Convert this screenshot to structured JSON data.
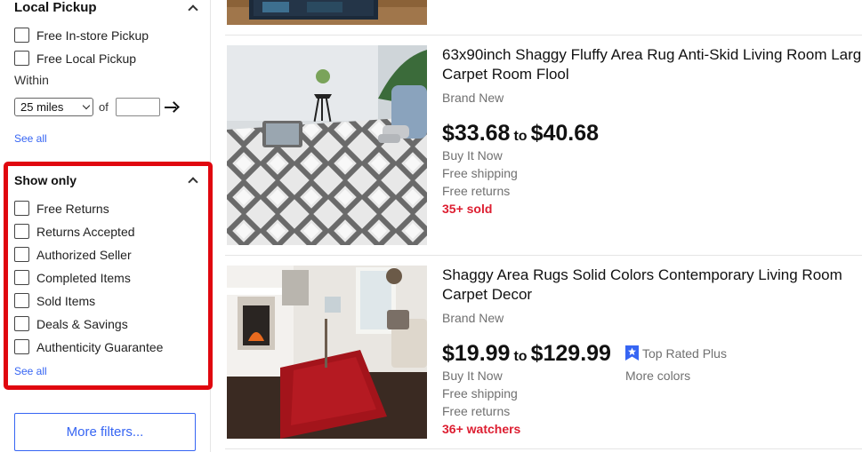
{
  "sidebar": {
    "local_pickup": {
      "heading": "Local Pickup",
      "options": [
        "Free In-store Pickup",
        "Free Local Pickup"
      ],
      "within_label": "Within",
      "distance_value": "25 miles",
      "of_label": "of",
      "zip_value": "",
      "see_all": "See all"
    },
    "show_only": {
      "heading": "Show only",
      "options": [
        "Free Returns",
        "Returns Accepted",
        "Authorized Seller",
        "Completed Items",
        "Sold Items",
        "Deals & Savings",
        "Authenticity Guarantee"
      ],
      "see_all": "See all"
    },
    "more_filters": "More filters..."
  },
  "listings": [
    {
      "title_line1": "63x90inch Shaggy Fluffy Area Rug Anti-Skid Living Room Larg",
      "title_line2": "Carpet Room Flool",
      "condition": "Brand New",
      "price_low": "$33.68",
      "price_to": "to",
      "price_high": "$40.68",
      "format": "Buy It Now",
      "shipping": "Free shipping",
      "returns": "Free returns",
      "sold": "35+ sold"
    },
    {
      "title_line1": "Shaggy Area Rugs Solid Colors Contemporary Living Room",
      "title_line2": "Carpet Decor",
      "condition": "Brand New",
      "price_low": "$19.99",
      "price_to": "to",
      "price_high": "$129.99",
      "format": "Buy It Now",
      "shipping": "Free shipping",
      "returns": "Free returns",
      "watchers": "36+ watchers",
      "badge": "Top Rated Plus",
      "more_colors": "More colors"
    }
  ],
  "colors": {
    "link": "#3665f3",
    "highlight": "#e0070f",
    "sold": "#dd1e31",
    "badge": "#3665f3"
  },
  "icons": {
    "collapse": "chevron-up-icon",
    "go": "arrow-right-icon",
    "badge": "top-rated-badge-icon"
  }
}
